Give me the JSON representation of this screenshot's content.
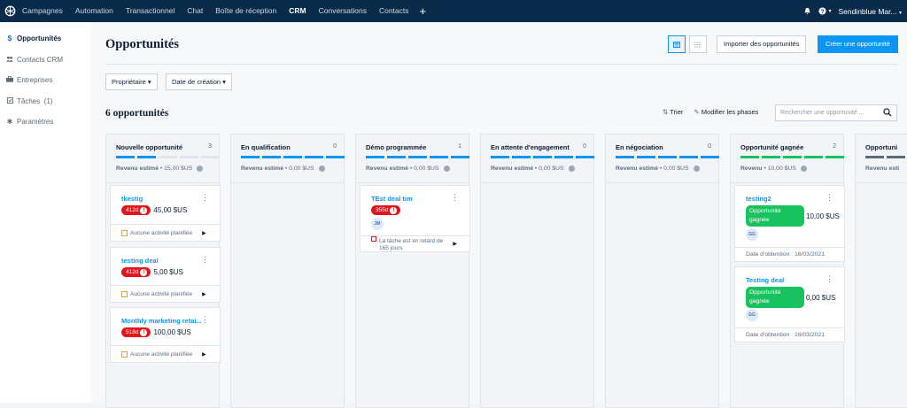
{
  "topbar": {
    "nav": [
      "Campagnes",
      "Automation",
      "Transactionnel",
      "Chat",
      "Boîte de réception",
      "CRM",
      "Conversations",
      "Contacts"
    ],
    "active": "CRM",
    "account": "Sendinblue Mar..."
  },
  "sidebar": {
    "items": [
      {
        "label": "Opportunités",
        "icon": "dollar-icon",
        "active": true
      },
      {
        "label": "Contacts CRM",
        "icon": "people-icon"
      },
      {
        "label": "Entreprises",
        "icon": "building-icon"
      },
      {
        "label": "Tâches  (1)",
        "icon": "checkbox-icon"
      },
      {
        "label": "Paramètres",
        "icon": "gear-icon"
      }
    ]
  },
  "header": {
    "title": "Opportunités",
    "import_label": "Importer des opportunités",
    "create_label": "Créer une opportunité"
  },
  "filters": {
    "owner": "Propriétaire ▾",
    "created": "Date de création ▾"
  },
  "toolbar": {
    "count": "6 opportunités",
    "sort": "Trier",
    "edit_phases": "Modifier les phases",
    "search_placeholder": "Rechercher une opportunité ..."
  },
  "columns": [
    {
      "name": "Nouvelle opportunité",
      "count": "3",
      "rev_label": "Revenu estimé",
      "rev": "15,00 $US",
      "bar_color": "#0b96f4",
      "filled": 2
    },
    {
      "name": "En qualification",
      "count": "0",
      "rev_label": "Revenu estimé",
      "rev": "0,00 $US",
      "bar_color": "#0b96f4",
      "filled": 5
    },
    {
      "name": "Démo programmée",
      "count": "1",
      "rev_label": "Revenu estimé",
      "rev": "0,00 $US",
      "bar_color": "#0b96f4",
      "filled": 5
    },
    {
      "name": "En attente d'engagement",
      "count": "0",
      "rev_label": "Revenu estimé",
      "rev": "0,00 $US",
      "bar_color": "#0b96f4",
      "filled": 5
    },
    {
      "name": "En négociation",
      "count": "0",
      "rev_label": "Revenu estimé",
      "rev": "0,00 $US",
      "bar_color": "#0b96f4",
      "filled": 5
    },
    {
      "name": "Opportunité gagnée",
      "count": "2",
      "rev_label": "Revenu",
      "rev": "10,00 $US",
      "bar_color": "#18c25f",
      "filled": 5
    },
    {
      "name": "Opportuni",
      "count": "",
      "rev_label": "Revenu esti",
      "rev": "",
      "bar_color": "#5b6b7c",
      "filled": 5
    }
  ],
  "cards": {
    "c1": {
      "title": "tkestig",
      "age": "412d",
      "value": "45,00 $US",
      "footer": "Aucune activité planifiée"
    },
    "c2": {
      "title": "testing deal",
      "age": "412d",
      "value": "5,00 $US",
      "footer": "Aucune activité planifiée"
    },
    "c3": {
      "title": "Monthly marketing retai...",
      "age": "518d",
      "value": "100,00 $US",
      "footer": "Aucune activité planifiée"
    },
    "c4": {
      "title": "TEst deal tim",
      "age": "355d",
      "avatar": "JM",
      "late": "La tâche est en retard de 165 jours"
    },
    "c5": {
      "title": "testing2",
      "badge": "Opportunité gagnée",
      "value": "10,00 $US",
      "avatar": "GG",
      "date": "Date d'obtention : 16/03/2021"
    },
    "c6": {
      "title": "Testing deal",
      "badge": "Opportunité gagnée",
      "value": "0,00 $US",
      "avatar": "GG",
      "date": "Date d'obtention : 16/03/2021"
    }
  }
}
